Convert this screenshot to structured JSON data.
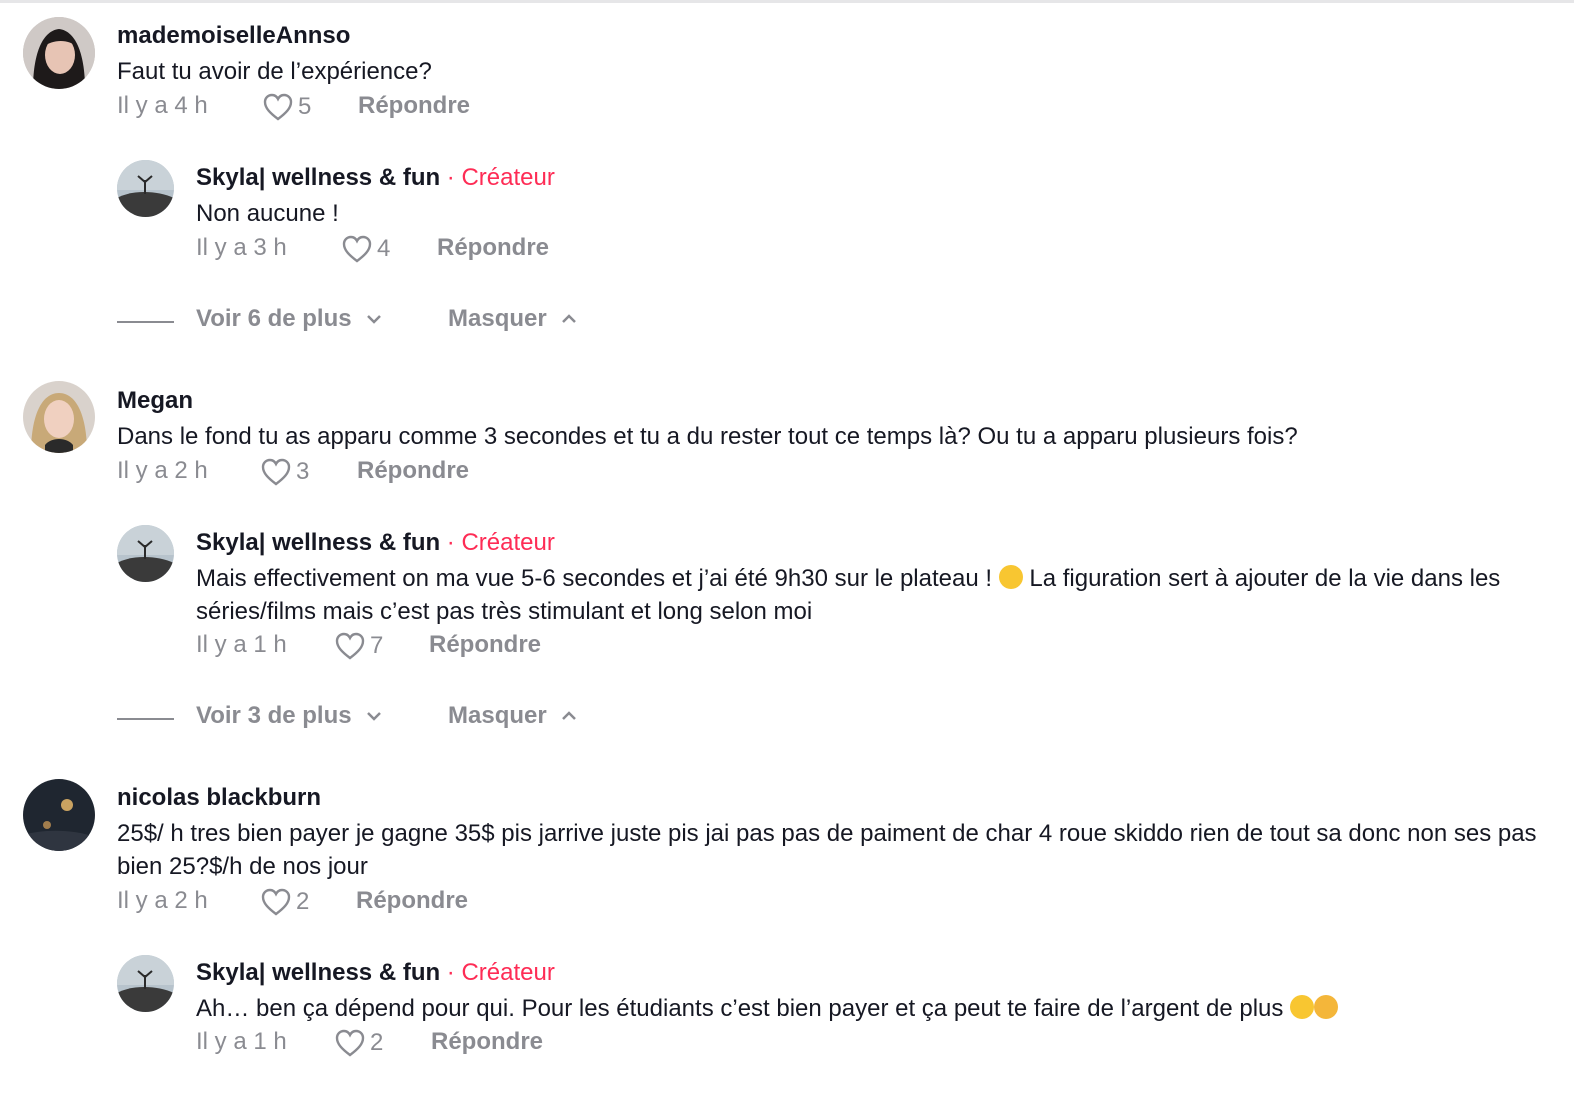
{
  "comments": [
    {
      "username": "mademoiselleAnnso",
      "text": "Faut tu avoir de l’expérience?",
      "time": "Il y a 4 h",
      "likes": "5",
      "reply": "Répondre",
      "replies": [
        {
          "username": "Skyla| wellness & fun",
          "badge": " · Créateur",
          "text": "Non aucune !",
          "time": "Il y a 3 h",
          "likes": "4",
          "reply": "Répondre"
        }
      ],
      "view_more": "Voir 6 de plus",
      "hide": "Masquer"
    },
    {
      "username": "Megan",
      "text": "Dans le fond tu as apparu comme 3 secondes et tu a du rester tout ce temps là? Ou tu a apparu plusieurs fois?",
      "time": "Il y a 2 h",
      "likes": "3",
      "reply": "Répondre",
      "replies": [
        {
          "username": "Skyla| wellness & fun",
          "badge": " · Créateur",
          "text_a": "Mais effectivement on ma vue 5-6 secondes et j’ai été 9h30 sur le plateau ! ",
          "text_b": " La figuration sert à ajouter de la vie dans les séries/films mais c’est pas très stimulant et long selon moi",
          "time": "Il y a 1 h",
          "likes": "7",
          "reply": "Répondre"
        }
      ],
      "view_more": "Voir 3 de plus",
      "hide": "Masquer"
    },
    {
      "username": "nicolas blackburn",
      "text": "25$/ h tres bien payer je gagne 35$ pis jarrive juste pis jai pas pas de paiment de char 4 roue skiddo rien de tout sa donc non ses pas bien 25?$/h de nos jour",
      "time": "Il y a 2 h",
      "likes": "2",
      "reply": "Répondre",
      "replies": [
        {
          "username": "Skyla| wellness & fun",
          "badge": " · Créateur",
          "text": "Ah… ben ça dépend pour qui. Pour les étudiants c’est bien payer et ça peut te faire de l’argent de plus ",
          "time": "Il y a 1 h",
          "likes": "2",
          "reply": "Répondre"
        }
      ]
    }
  ],
  "colors": {
    "creator": "#fe2c55",
    "meta": "#8a8b91",
    "text": "#161823"
  }
}
